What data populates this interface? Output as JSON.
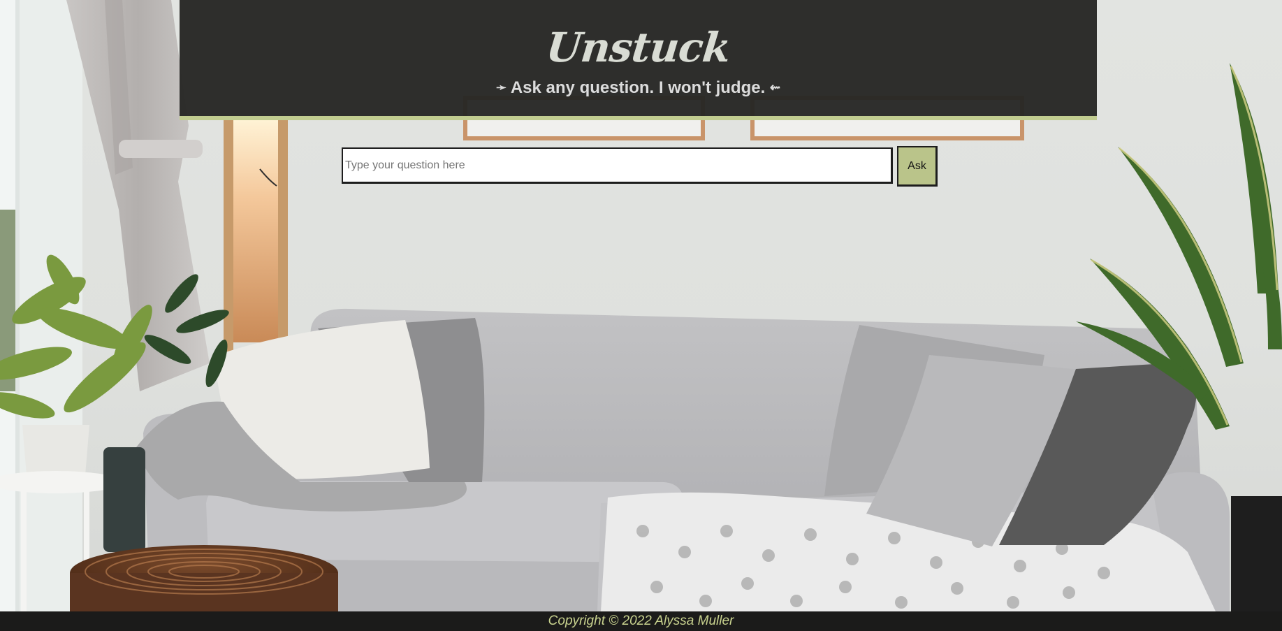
{
  "header": {
    "title": "Unstuck",
    "tagline": "Ask any question. I won't judge.",
    "tagline_left_arrow": "➛",
    "tagline_right_arrow": "⇜"
  },
  "form": {
    "input_placeholder": "Type your question here",
    "input_value": "",
    "ask_label": "Ask"
  },
  "footer": {
    "copyright": "Copyright © 2022 Alyssa Muller"
  },
  "colors": {
    "header_bg": "#262624",
    "accent": "#c1cc90",
    "button_bg": "#bac48a",
    "footer_text": "#c9d38f",
    "footer_bg": "#1b1b1a"
  },
  "background": {
    "image": "living-room-photo"
  }
}
